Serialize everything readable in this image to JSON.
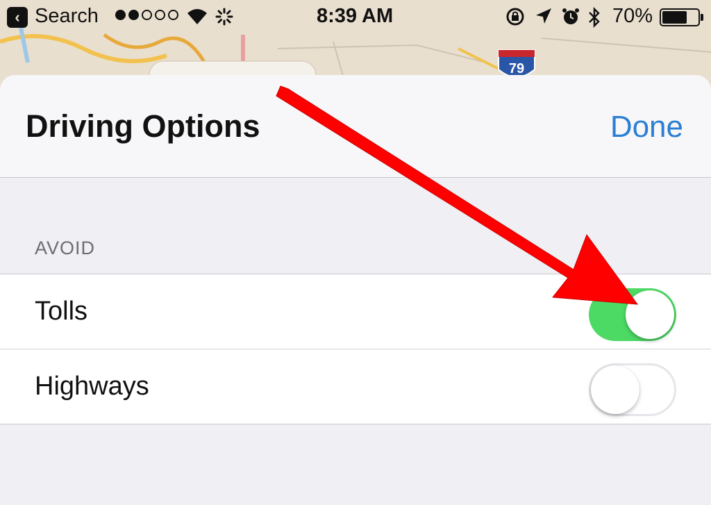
{
  "status_bar": {
    "back_label": "Search",
    "signal_bars_filled": 2,
    "signal_bars_total": 5,
    "time": "8:39 AM",
    "battery_percent": "70%",
    "battery_level": 0.7,
    "icons": [
      "back-icon",
      "wifi-icon",
      "activity-spinner-icon",
      "rotation-lock-icon",
      "location-arrow-icon",
      "alarm-icon",
      "bluetooth-icon",
      "battery-icon"
    ]
  },
  "map": {
    "interstate_shield": "79"
  },
  "sheet": {
    "title": "Driving Options",
    "done_label": "Done",
    "section_header": "AVOID",
    "options": [
      {
        "label": "Tolls",
        "enabled": true
      },
      {
        "label": "Highways",
        "enabled": false
      }
    ]
  },
  "colors": {
    "accent": "#2a7fd4",
    "toggle_on": "#4cd964",
    "annotation_arrow": "#ff0000"
  }
}
